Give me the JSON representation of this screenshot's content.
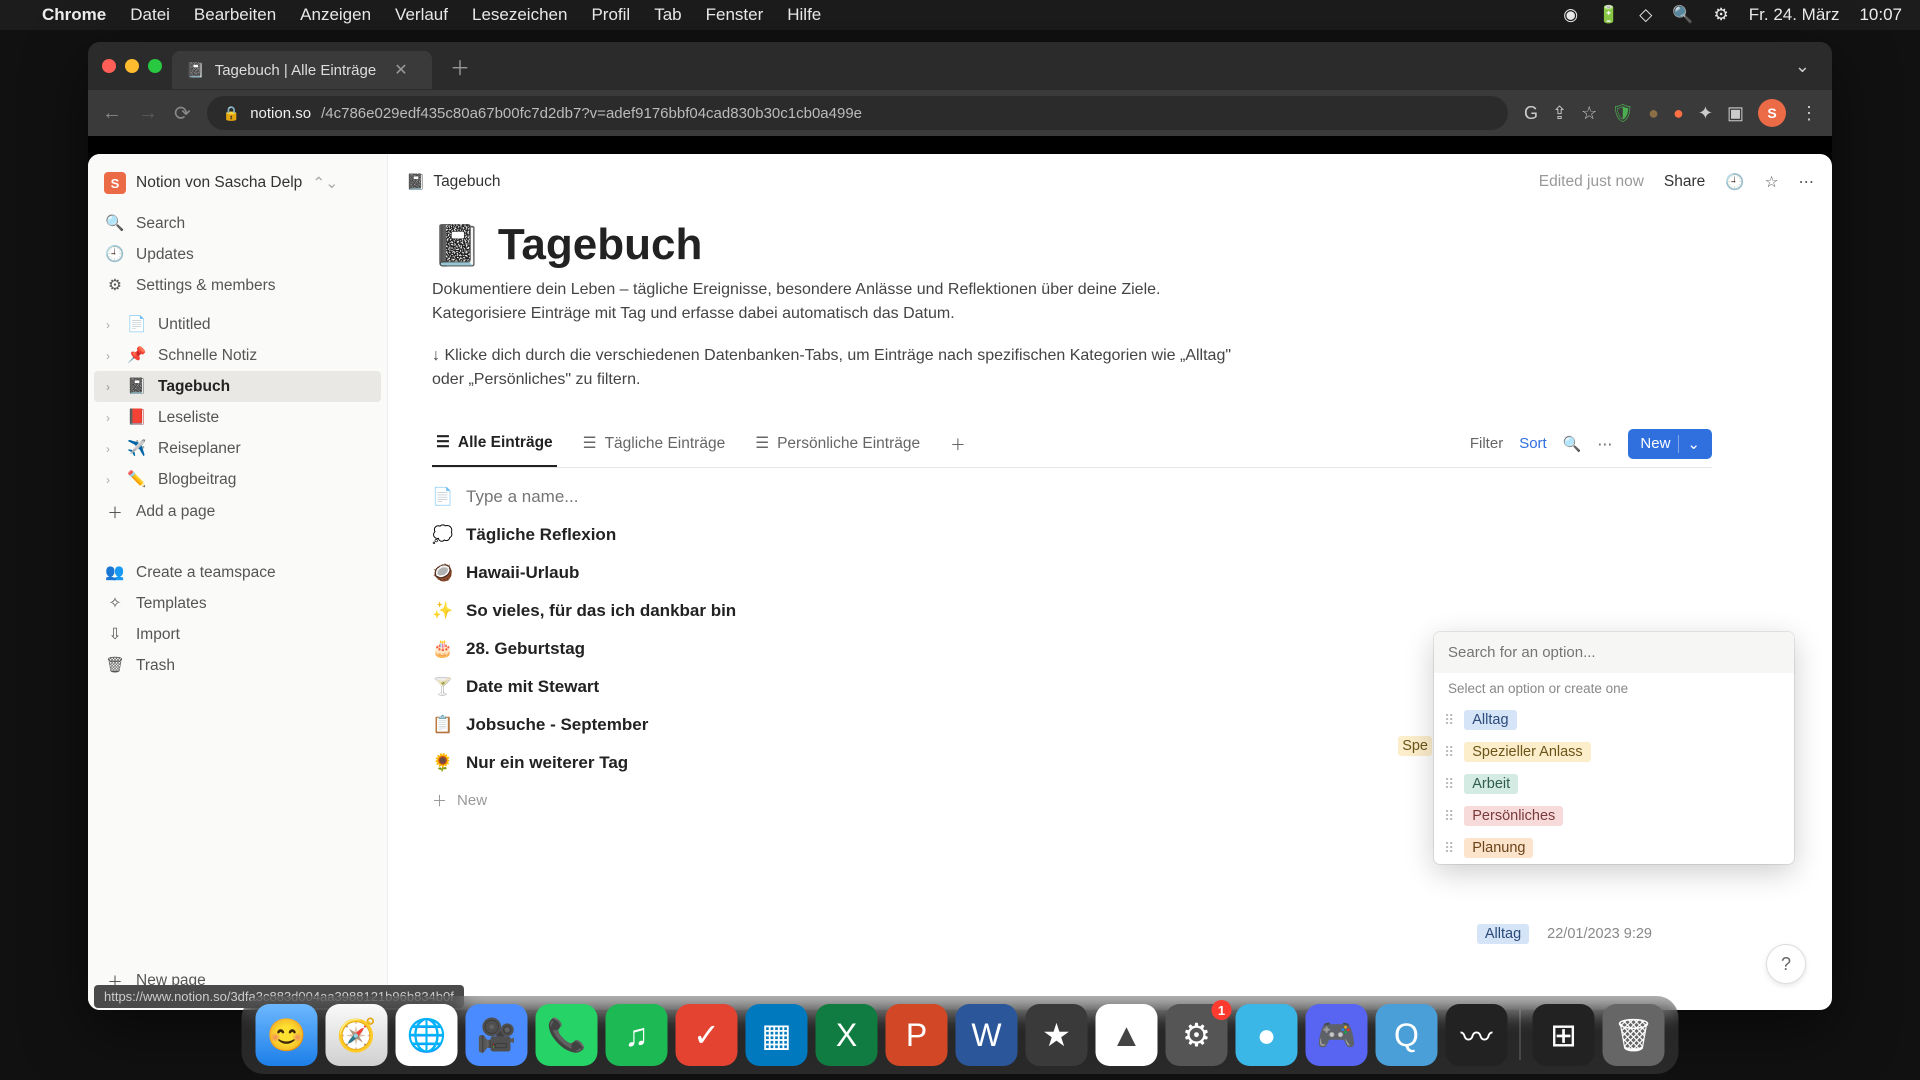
{
  "menubar": {
    "app": "Chrome",
    "items": [
      "Datei",
      "Bearbeiten",
      "Anzeigen",
      "Verlauf",
      "Lesezeichen",
      "Profil",
      "Tab",
      "Fenster",
      "Hilfe"
    ],
    "date": "Fr. 24. März",
    "time": "10:07"
  },
  "browser": {
    "tab_title": "Tagebuch | Alle Einträge",
    "url_host": "notion.so",
    "url_path": "/4c786e029edf435c80a67b00fc7d2db7?v=adef9176bbf04cad830b30c1cb0a499e",
    "avatar_letter": "S"
  },
  "workspace": {
    "badge": "S",
    "name": "Notion von Sascha Delp"
  },
  "side": {
    "search": "Search",
    "updates": "Updates",
    "settings": "Settings & members",
    "pages": [
      {
        "emoji": "",
        "label": "Untitled"
      },
      {
        "emoji": "📌",
        "label": "Schnelle Notiz"
      },
      {
        "emoji": "📓",
        "label": "Tagebuch",
        "active": true
      },
      {
        "emoji": "📕",
        "label": "Leseliste"
      },
      {
        "emoji": "✈️",
        "label": "Reiseplaner"
      },
      {
        "emoji": "✏️",
        "label": "Blogbeitrag"
      }
    ],
    "add_page": "Add a page",
    "teamspace": "Create a teamspace",
    "templates": "Templates",
    "import": "Import",
    "trash": "Trash",
    "new_page": "New page"
  },
  "topbar": {
    "crumb_emoji": "📓",
    "crumb": "Tagebuch",
    "edited": "Edited just now",
    "share": "Share"
  },
  "page": {
    "icon": "📓",
    "title": "Tagebuch",
    "desc": "Dokumentiere dein Leben – tägliche Ereignisse, besondere Anlässe und Reflektionen über deine Ziele. Kategorisiere Einträge mit Tag und erfasse dabei automatisch das Datum.",
    "hint": "↓ Klicke dich durch die verschiedenen Datenbanken-Tabs, um Einträge nach spezifischen Kategorien wie „Alltag\" oder „Persönliches\" zu filtern."
  },
  "db": {
    "views": [
      "Alle Einträge",
      "Tägliche Einträge",
      "Persönliche Einträge"
    ],
    "filter": "Filter",
    "sort": "Sort",
    "new": "New",
    "name_placeholder": "Type a name...",
    "rows": [
      {
        "emoji": "💭",
        "title": "Tägliche Reflexion"
      },
      {
        "emoji": "🥥",
        "title": "Hawaii-Urlaub"
      },
      {
        "emoji": "✨",
        "title": "So vieles, für das ich dankbar bin"
      },
      {
        "emoji": "🎂",
        "title": "28. Geburtstag"
      },
      {
        "emoji": "🍸",
        "title": "Date mit Stewart"
      },
      {
        "emoji": "📋",
        "title": "Jobsuche - September"
      },
      {
        "emoji": "🌻",
        "title": "Nur ein weiterer Tag"
      }
    ],
    "addrow": "New",
    "visible_tag": {
      "label": "Alltag",
      "date": "22/01/2023 9:29"
    },
    "partial_tag": "Spe"
  },
  "popup": {
    "placeholder": "Search for an option...",
    "label": "Select an option or create one",
    "options": [
      {
        "text": "Alltag",
        "cls": "t-alltag"
      },
      {
        "text": "Spezieller Anlass",
        "cls": "t-spez"
      },
      {
        "text": "Arbeit",
        "cls": "t-arbeit"
      },
      {
        "text": "Persönliches",
        "cls": "t-pers"
      },
      {
        "text": "Planung",
        "cls": "t-plan"
      }
    ]
  },
  "urltip": "https://www.notion.so/3dfa3c883d004aa3988121b96b834b0f",
  "dock": [
    "Finder",
    "Safari",
    "Chrome",
    "Zoom",
    "WhatsApp",
    "Spotify",
    "Todoist",
    "Trello",
    "Excel",
    "PowerPoint",
    "Word",
    "iMovie",
    "Drive",
    "Settings",
    "Globe",
    "Discord",
    "QuickTime",
    "Voice",
    "MissionControl",
    "Trash"
  ]
}
